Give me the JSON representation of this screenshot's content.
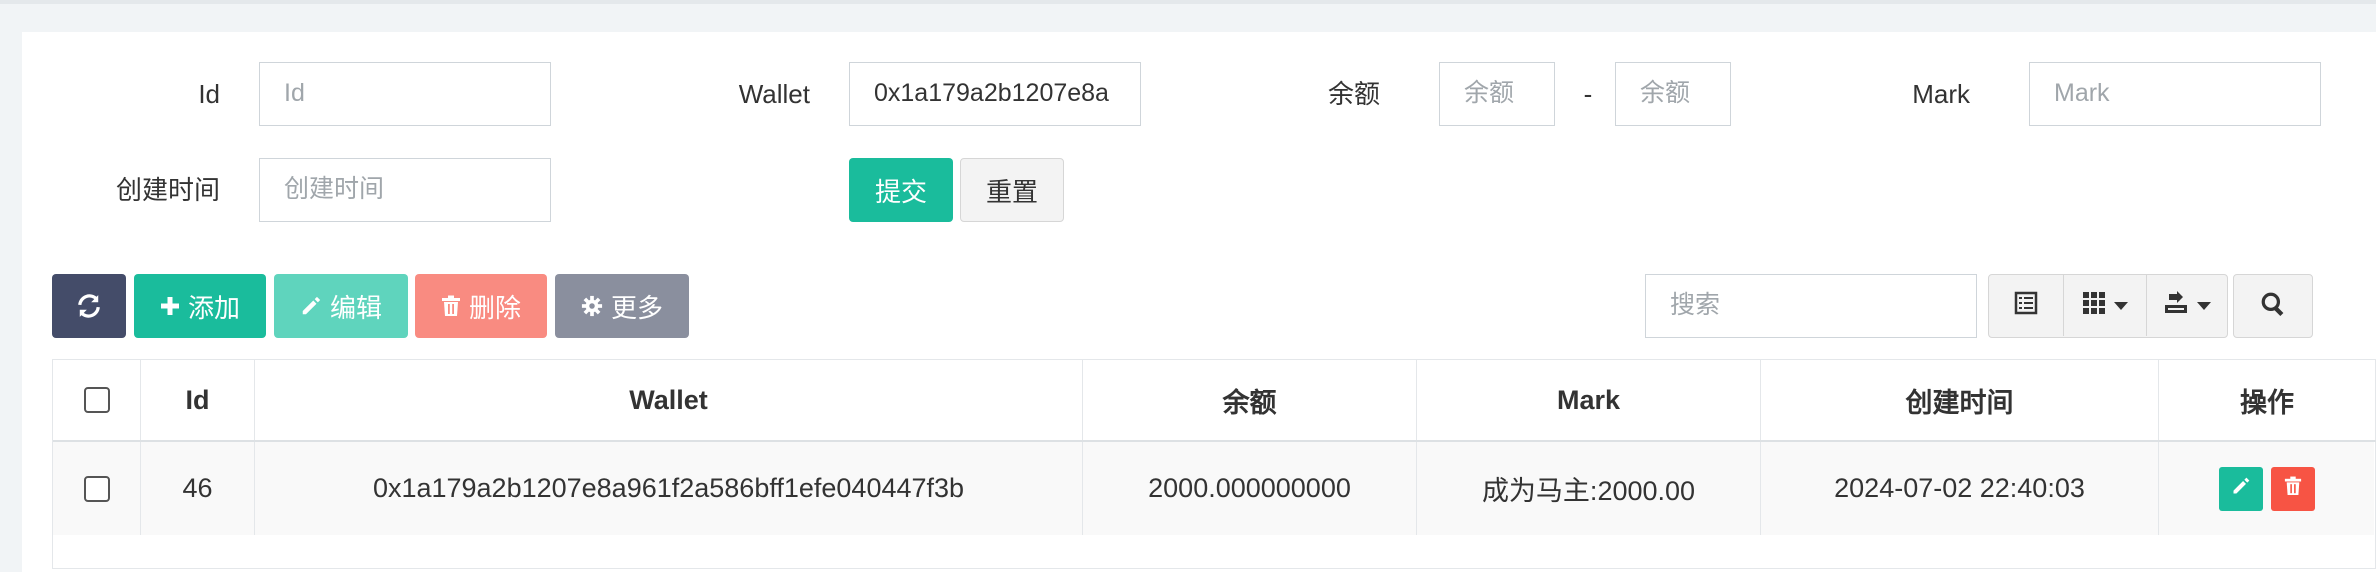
{
  "form": {
    "id_label": "Id",
    "id_placeholder": "Id",
    "wallet_label": "Wallet",
    "wallet_value": "0x1a179a2b1207e8a",
    "balance_label": "余额",
    "balance_min_placeholder": "余额",
    "balance_separator": "-",
    "balance_max_placeholder": "余额",
    "mark_label": "Mark",
    "mark_placeholder": "Mark",
    "created_label": "创建时间",
    "created_placeholder": "创建时间",
    "submit_label": "提交",
    "reset_label": "重置"
  },
  "toolbar": {
    "add_label": "添加",
    "edit_label": "编辑",
    "delete_label": "删除",
    "more_label": "更多",
    "search_placeholder": "搜索"
  },
  "table": {
    "columns": [
      "Id",
      "Wallet",
      "余额",
      "Mark",
      "创建时间",
      "操作"
    ],
    "rows": [
      {
        "id": "46",
        "wallet": "0x1a179a2b1207e8a961f2a586bff1efe040447f3b",
        "balance": "2000.000000000",
        "mark": "成为马主:2000.00",
        "created": "2024-07-02 22:40:03"
      }
    ]
  },
  "colors": {
    "primary": "#1abc9c",
    "dark": "#444c69",
    "danger": "#f75444",
    "danger_light": "#f98b81",
    "success_light": "#5fd4bd",
    "gray": "#8a8f9e"
  }
}
